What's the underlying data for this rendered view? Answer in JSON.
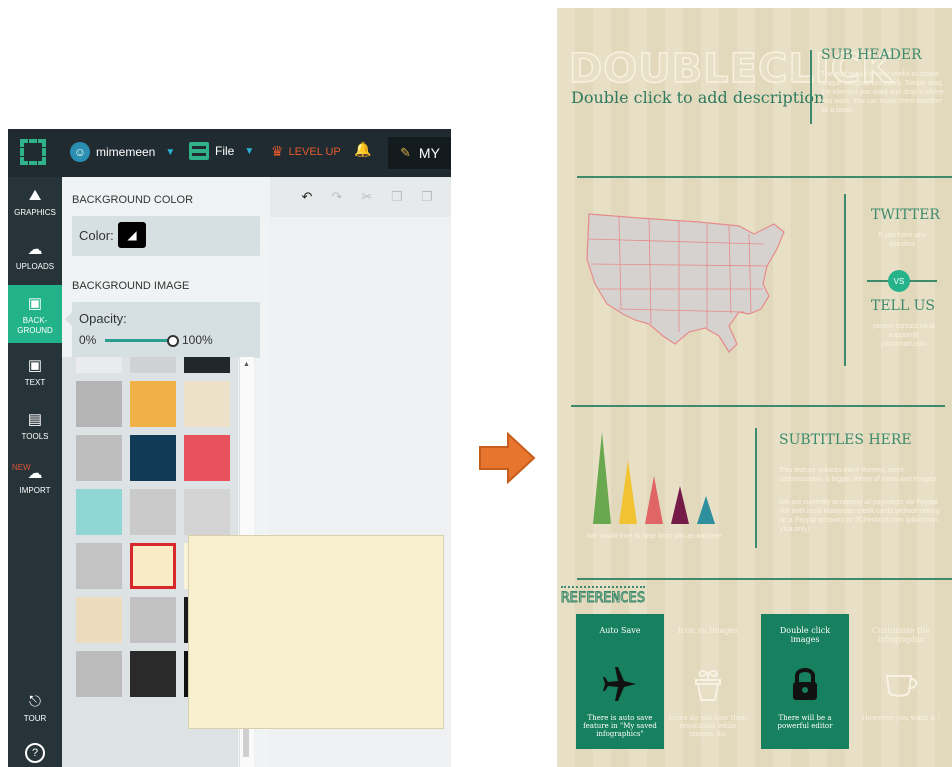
{
  "app": {
    "username": "mimemeen",
    "file_label": "File",
    "levelup_label": "LEVEL UP",
    "my_tab_label": "MY",
    "nav": {
      "graphics": "GRAPHICS",
      "uploads": "UPLOADS",
      "background": "BACK- GROUND",
      "text": "TEXT",
      "tools": "TOOLS",
      "import_new": "NEW",
      "import": "IMPORT",
      "tour": "TOUR"
    },
    "panel": {
      "background_color_heading": "BACKGROUND COLOR",
      "color_label": "Color:",
      "color_value": "#000000",
      "background_image_heading": "BACKGROUND IMAGE",
      "opacity_label": "Opacity:",
      "opacity_min": "0%",
      "opacity_max": "100%",
      "opacity_value": 1.0
    },
    "texture_tiles": [
      {
        "name": "texture-white-speckle",
        "color": "#e9ebec"
      },
      {
        "name": "texture-grey-check",
        "color": "#cfd1d3"
      },
      {
        "name": "texture-dark-navy",
        "color": "#22272e"
      },
      {
        "name": "texture-grey-diagonal",
        "color": "#b4b4b4"
      },
      {
        "name": "texture-wood-crate",
        "color": "#f0b248"
      },
      {
        "name": "texture-light-wood",
        "color": "#ede0c9"
      },
      {
        "name": "texture-grey-dots",
        "color": "#bebebe"
      },
      {
        "name": "texture-dark-teal",
        "color": "#103a55"
      },
      {
        "name": "texture-coral-red",
        "color": "#e8525d"
      },
      {
        "name": "texture-aqua-watercolor",
        "color": "#8fd6d4"
      },
      {
        "name": "texture-grey-grain",
        "color": "#cacaca"
      },
      {
        "name": "texture-light-grey",
        "color": "#d4d4d4"
      },
      {
        "name": "texture-grey-plain",
        "color": "#c3c3c3"
      },
      {
        "name": "texture-cream-selected",
        "color": "#f8ecc6"
      },
      {
        "name": "texture-cream",
        "color": "#faf3dc"
      },
      {
        "name": "texture-tan",
        "color": "#ecdcbd"
      },
      {
        "name": "texture-grey-fold",
        "color": "#c2c2c2"
      },
      {
        "name": "texture-black",
        "color": "#1a1a1a"
      },
      {
        "name": "texture-grey-lines",
        "color": "#bcbcbc"
      },
      {
        "name": "texture-dark-grey",
        "color": "#2a2a2a"
      },
      {
        "name": "texture-black-dots",
        "color": "#111111"
      }
    ],
    "selected_tile_index": 13,
    "accent_color": "#22b38b",
    "selection_color": "#d7282b"
  },
  "infographic": {
    "title": "DOUBLECLICK",
    "description": "Double click to add description",
    "sub_header": "SUB HEADER",
    "sub_header_body": "The edit layout is very useful to create unique infographics easily. Simply drag the element you want and drop it where you want. You can move them together as a block.",
    "twitter": "TWITTER",
    "twitter_body": "If you have any question",
    "vs": "VS",
    "tell_us": "TELL US",
    "tell_us_body": "please contact us at support@ piktochart.com",
    "subtitles": "SUBTITLES HERE",
    "subtitles_body_1": "This feature unlocks more themes, more customization, a bigger library of icons and images.",
    "subtitles_body_2": "We are currently accepting all payments via Paypal (for both local Malaysian credit cards without setting up a Paypal account) or 2Checkout.com (piktochart Visa only).",
    "chart_caption": "We would love to hear from you as anytime",
    "references": "REFERENCES",
    "cards": [
      {
        "title": "Auto Save",
        "body": "There is auto save feature in \"My saved infographics\"",
        "icon": "airplane-icon",
        "style": "dark"
      },
      {
        "title": "Icon vs Images",
        "body": "Icons do not lose their resolution while images do.",
        "icon": "plant-pot-icon",
        "style": "light"
      },
      {
        "title": "Double click images",
        "body": "There will be a powerful editor",
        "icon": "lock-icon",
        "style": "dark"
      },
      {
        "title": "Customize the infographic",
        "body": "However you want it !",
        "icon": "cup-icon",
        "style": "light"
      }
    ],
    "triangle_colors": [
      "#6aa84f",
      "#f1c232",
      "#e06666",
      "#741b47",
      "#2f8f9d"
    ],
    "theme_green": "#3d8a6c"
  }
}
